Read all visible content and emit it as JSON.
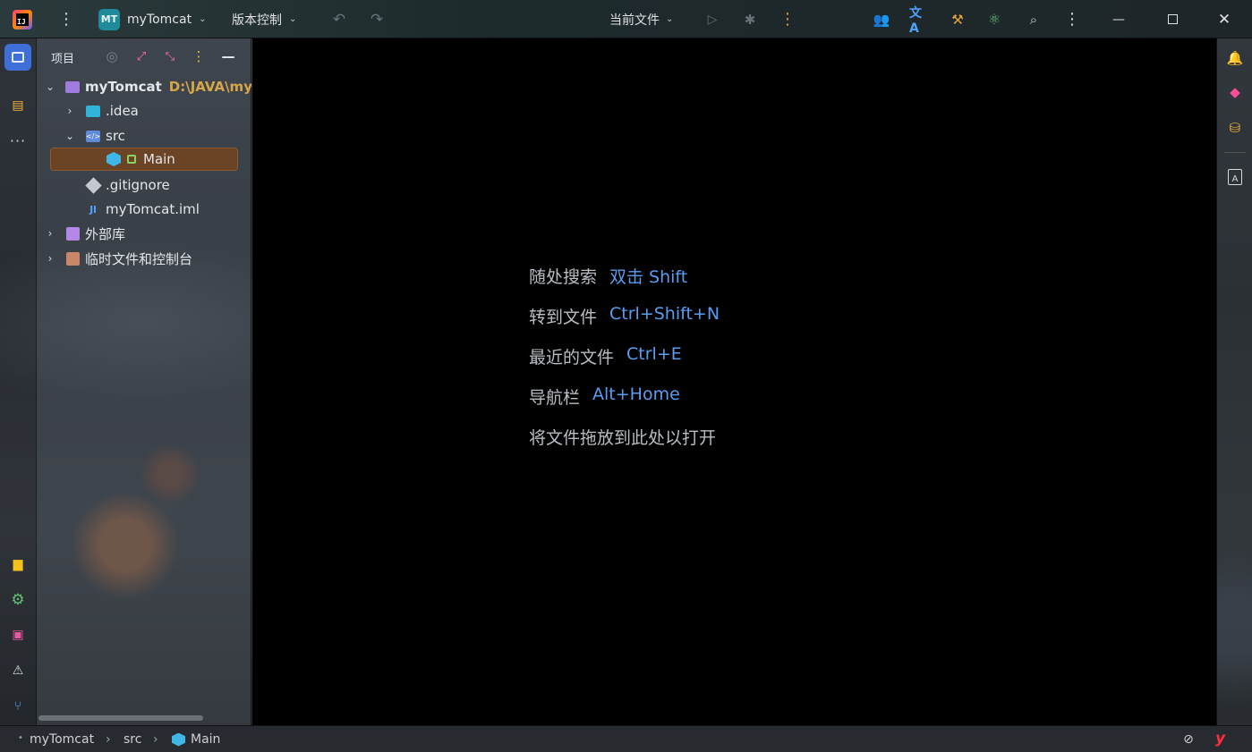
{
  "titlebar": {
    "logo_text": "IJ",
    "main_menu_icon": "hamburger-dots",
    "project_badge": "MT",
    "project_name": "myTomcat",
    "vcs_label": "版本控制",
    "run_config_label": "当前文件"
  },
  "left_toolbar": {
    "items": [
      "project-icon",
      "structure-icon",
      "more-icon",
      "build-icon",
      "services-icon",
      "terminal-icon",
      "problems-icon",
      "git-icon"
    ]
  },
  "project_panel": {
    "title": "项目",
    "tree": [
      {
        "label": "myTomcat",
        "path_hint": "D:\\JAVA\\my",
        "expanded": true
      },
      {
        "label": ".idea",
        "expanded": false
      },
      {
        "label": "src",
        "expanded": true
      },
      {
        "label": "Main",
        "selected": true
      },
      {
        "label": ".gitignore"
      },
      {
        "label": "myTomcat.iml"
      },
      {
        "label": "外部库",
        "expanded": false
      },
      {
        "label": "临时文件和控制台",
        "expanded": false
      }
    ]
  },
  "editor": {
    "hints": [
      {
        "action": "随处搜索",
        "shortcut": "双击 Shift"
      },
      {
        "action": "转到文件",
        "shortcut": "Ctrl+Shift+N"
      },
      {
        "action": "最近的文件",
        "shortcut": "Ctrl+E"
      },
      {
        "action": "导航栏",
        "shortcut": "Alt+Home"
      },
      {
        "action": "将文件拖放到此处以打开",
        "shortcut": ""
      }
    ]
  },
  "statusbar": {
    "breadcrumb": [
      "myTomcat",
      "src",
      "Main"
    ],
    "plugin_badge": "y"
  },
  "colors": {
    "accent_blue": "#3f6fd8",
    "selection": "#6b4426",
    "shortcut_text": "#5a9cf0",
    "path_hint": "#d6a74a"
  }
}
